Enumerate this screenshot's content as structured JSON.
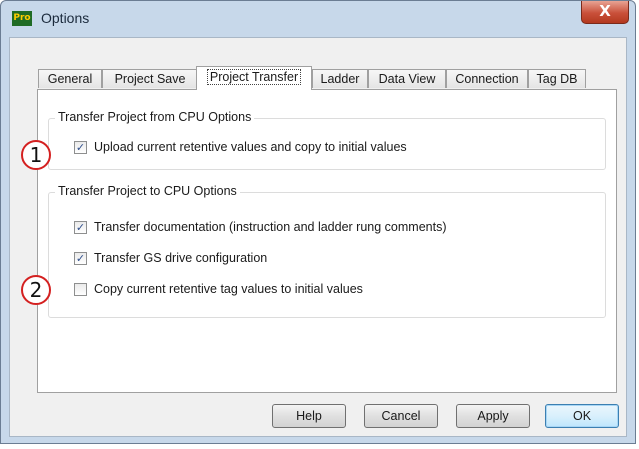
{
  "window": {
    "app_icon": "Pro",
    "title": "Options",
    "close_label": "X"
  },
  "tabs": [
    {
      "label": "General"
    },
    {
      "label": "Project Save"
    },
    {
      "label": "Project Transfer",
      "active": true
    },
    {
      "label": "Ladder"
    },
    {
      "label": "Data View"
    },
    {
      "label": "Connection"
    },
    {
      "label": "Tag DB"
    }
  ],
  "groups": {
    "from_cpu": {
      "title": "Transfer Project from CPU Options",
      "options": [
        {
          "label": "Upload current retentive values and copy to initial values",
          "checked": true
        }
      ]
    },
    "to_cpu": {
      "title": "Transfer Project to CPU Options",
      "options": [
        {
          "label": "Transfer documentation (instruction and ladder rung comments)",
          "checked": true
        },
        {
          "label": "Transfer GS drive configuration",
          "checked": true
        },
        {
          "label": "Copy current retentive tag values to initial values",
          "checked": false
        }
      ]
    }
  },
  "markers": [
    "1",
    "2"
  ],
  "buttons": {
    "help": "Help",
    "cancel": "Cancel",
    "apply": "Apply",
    "ok": "OK"
  },
  "check_glyph": "✓",
  "colors": {
    "close_button": "#c9503a",
    "marker_border": "#d42020",
    "frame": "#c7d8ea"
  }
}
